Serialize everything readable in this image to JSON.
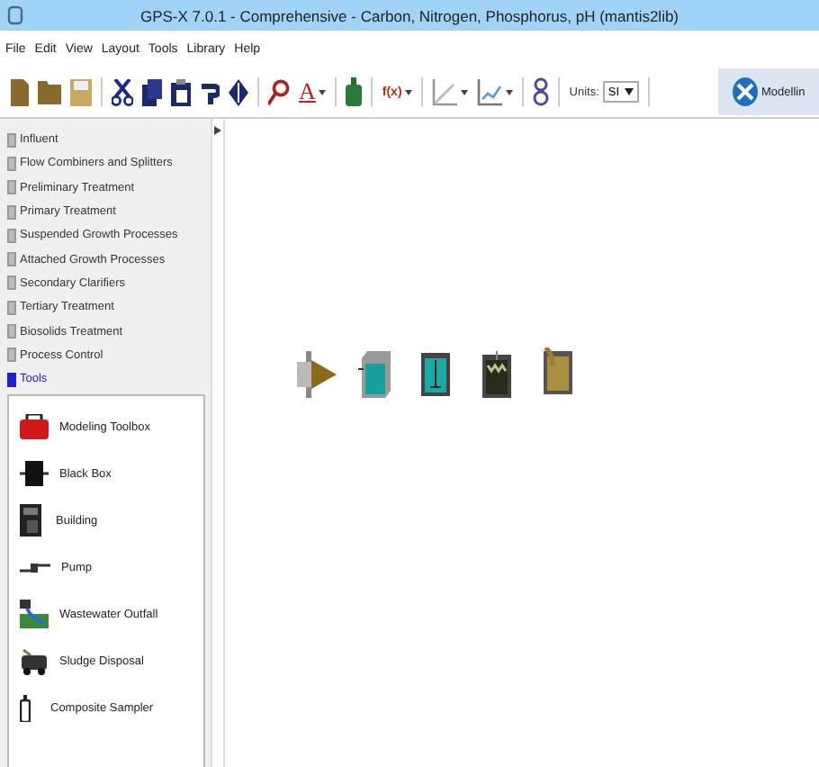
{
  "window": {
    "title": "GPS-X 7.0.1  - Comprehensive - Carbon, Nitrogen, Phosphorus, pH (mantis2lib)"
  },
  "menu": [
    {
      "label": "File"
    },
    {
      "label": "Edit"
    },
    {
      "label": "View"
    },
    {
      "label": "Layout"
    },
    {
      "label": "Tools"
    },
    {
      "label": "Library"
    },
    {
      "label": "Help"
    }
  ],
  "toolbar": {
    "font_button": "A",
    "function_button": "f(x)",
    "units_label": "Units:",
    "units_value": "SI",
    "mode_button": "Modellin"
  },
  "categories": [
    {
      "label": "Influent",
      "selected": false
    },
    {
      "label": "Flow Combiners and Splitters",
      "selected": false
    },
    {
      "label": "Preliminary Treatment",
      "selected": false
    },
    {
      "label": "Primary Treatment",
      "selected": false
    },
    {
      "label": "Suspended Growth Processes",
      "selected": false
    },
    {
      "label": "Attached Growth Processes",
      "selected": false
    },
    {
      "label": "Secondary Clarifiers",
      "selected": false
    },
    {
      "label": "Tertiary Treatment",
      "selected": false
    },
    {
      "label": "Biosolids Treatment",
      "selected": false
    },
    {
      "label": "Process Control",
      "selected": false
    },
    {
      "label": "Tools",
      "selected": true
    }
  ],
  "tools": [
    {
      "label": "Modeling Toolbox",
      "kind": "toolbox"
    },
    {
      "label": "Black Box",
      "kind": "blackbox"
    },
    {
      "label": "Building",
      "kind": "building"
    },
    {
      "label": "Pump",
      "kind": "pump"
    },
    {
      "label": "Wastewater Outfall",
      "kind": "outfall"
    },
    {
      "label": "Sludge Disposal",
      "kind": "sludge"
    },
    {
      "label": "Composite Sampler",
      "kind": "sampler"
    }
  ]
}
